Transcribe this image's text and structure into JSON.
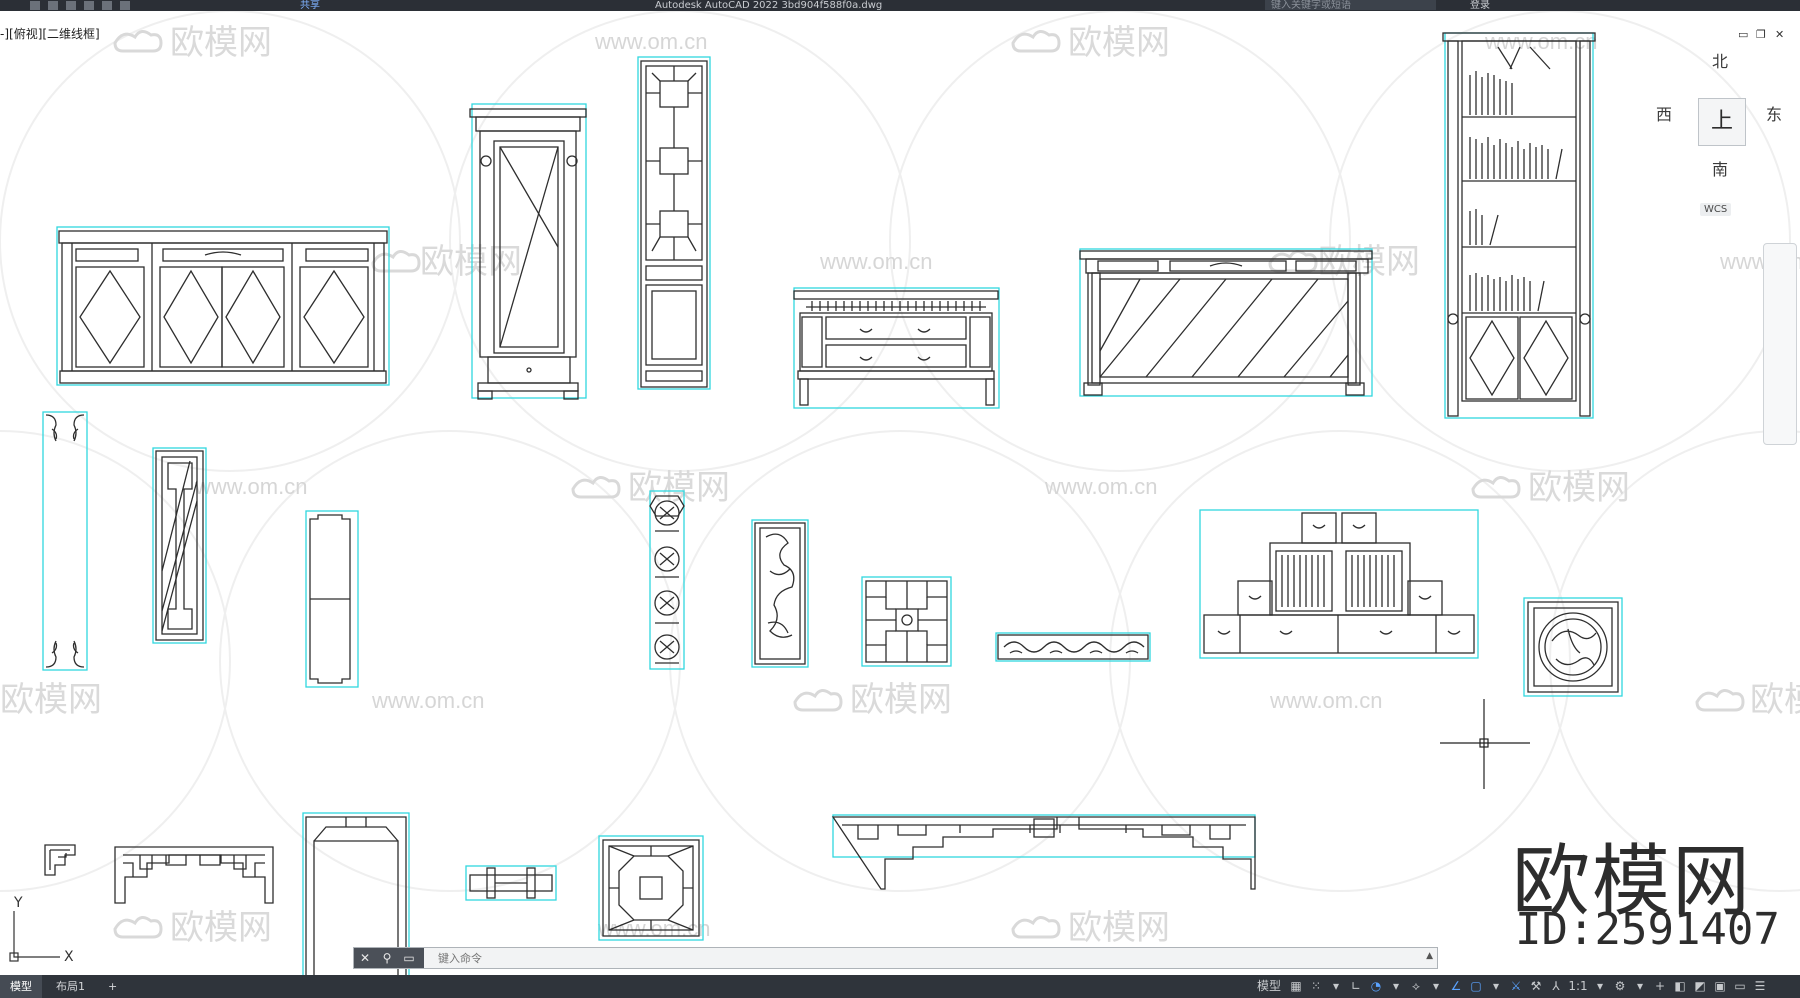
{
  "title_bar": {
    "window_title": "Autodesk AutoCAD 2022    3bd904f588f0a.dwg",
    "share_label": "共享",
    "search_placeholder": "键入关键字或短语",
    "signin_label": "登录"
  },
  "viewport": {
    "label": "-][俯视][二维线框]"
  },
  "watermark": {
    "brand": "欧模网",
    "url": "www.om.cn"
  },
  "viewcube": {
    "north": "北",
    "south": "南",
    "east": "东",
    "west": "西",
    "face": "上",
    "wcs": "WCS"
  },
  "ucs": {
    "x_label": "X",
    "y_label": "Y"
  },
  "brand": {
    "name": "欧模网",
    "id": "ID:2591407"
  },
  "command_line": {
    "placeholder": "键入命令"
  },
  "status_bar": {
    "tabs": [
      "模型",
      "布局1",
      "+"
    ],
    "model_label": "模型",
    "scale": "1:1"
  },
  "colors": {
    "outline": "#31d7df",
    "linework": "#2e2e2e",
    "ui_dark": "#2f343b",
    "accent": "#5aa3ff"
  }
}
